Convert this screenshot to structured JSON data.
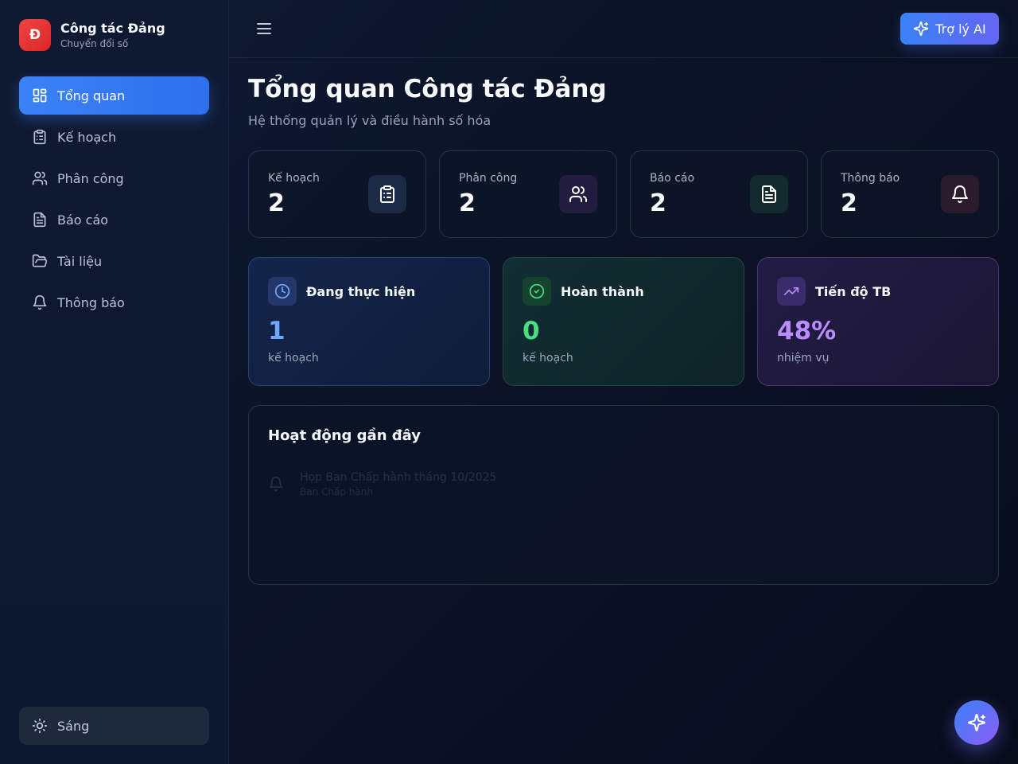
{
  "brand": {
    "logo_letter": "Đ",
    "title": "Công tác Đảng",
    "subtitle": "Chuyển đổi số"
  },
  "sidebar": {
    "items": [
      {
        "label": "Tổng quan",
        "icon": "dashboard-icon",
        "active": true
      },
      {
        "label": "Kế hoạch",
        "icon": "clipboard-icon"
      },
      {
        "label": "Phân công",
        "icon": "users-icon"
      },
      {
        "label": "Báo cáo",
        "icon": "file-text-icon"
      },
      {
        "label": "Tài liệu",
        "icon": "folder-icon"
      },
      {
        "label": "Thông báo",
        "icon": "bell-icon"
      }
    ],
    "theme_label": "Sáng"
  },
  "topbar": {
    "ai_label": "Trợ lý AI"
  },
  "page": {
    "title": "Tổng quan Công tác Đảng",
    "subtitle": "Hệ thống quản lý và điều hành số hóa"
  },
  "stats": [
    {
      "label": "Kế hoạch",
      "value": "2",
      "icon": "clipboard-icon"
    },
    {
      "label": "Phân công",
      "value": "2",
      "icon": "users-icon"
    },
    {
      "label": "Báo cáo",
      "value": "2",
      "icon": "file-text-icon"
    },
    {
      "label": "Thông báo",
      "value": "2",
      "icon": "bell-icon"
    }
  ],
  "summary": [
    {
      "title": "Đang thực hiện",
      "value": "1",
      "unit": "kế hoạch",
      "icon": "clock-icon",
      "color": "#6ea8ff"
    },
    {
      "title": "Hoàn thành",
      "value": "0",
      "unit": "kế hoạch",
      "icon": "check-circle-icon",
      "color": "#4ade80"
    },
    {
      "title": "Tiến độ TB",
      "value": "48%",
      "unit": "nhiệm vụ",
      "icon": "trending-up-icon",
      "color": "#b98cff"
    }
  ],
  "activity": {
    "title": "Hoạt động gần đây",
    "items": [
      {
        "title": "Họp Ban Chấp hành tháng 10/2025",
        "subtitle": "Ban Chấp hành",
        "icon": "bell-icon"
      }
    ]
  },
  "colors": {
    "accent": "#3b82f6",
    "brand_red": "#ef4444",
    "purple": "#8b5cf6"
  }
}
